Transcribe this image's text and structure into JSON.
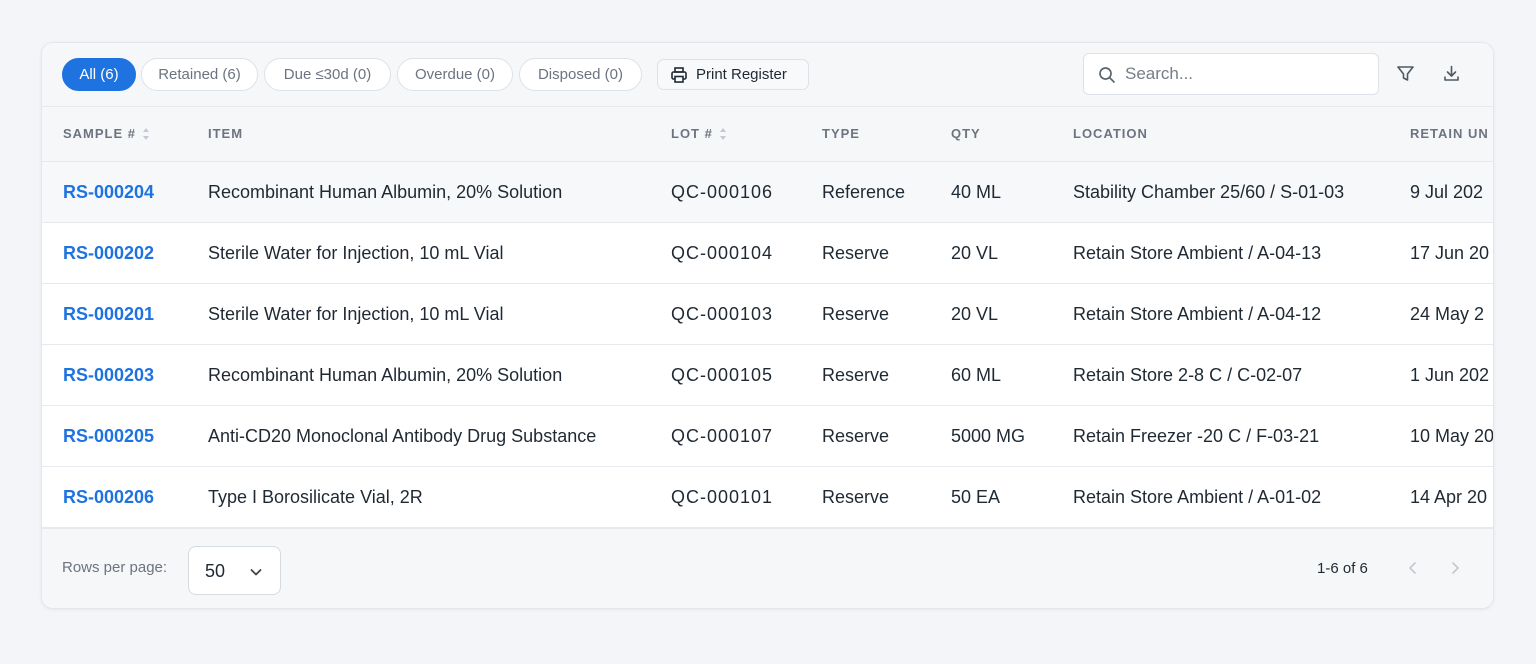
{
  "filters": [
    {
      "label": "All (6)",
      "active": true
    },
    {
      "label": "Retained (6)",
      "active": false
    },
    {
      "label": "Due ≤30d (0)",
      "active": false
    },
    {
      "label": "Overdue (0)",
      "active": false
    },
    {
      "label": "Disposed (0)",
      "active": false
    }
  ],
  "toolbar": {
    "print_label": "Print Register",
    "search_placeholder": "Search..."
  },
  "columns": {
    "sample": "SAMPLE #",
    "item": "ITEM",
    "lot": "LOT #",
    "type": "TYPE",
    "qty": "QTY",
    "location": "LOCATION",
    "retain_until": "RETAIN UN"
  },
  "rows": [
    {
      "sample": "RS-000204",
      "item": "Recombinant Human Albumin, 20% Solution",
      "lot": "QC-000106",
      "type": "Reference",
      "qty": "40 ML",
      "location": "Stability Chamber 25/60 / S-01-03",
      "retain_until": "9 Jul 202"
    },
    {
      "sample": "RS-000202",
      "item": "Sterile Water for Injection, 10 mL Vial",
      "lot": "QC-000104",
      "type": "Reserve",
      "qty": "20 VL",
      "location": "Retain Store Ambient / A-04-13",
      "retain_until": "17 Jun 20"
    },
    {
      "sample": "RS-000201",
      "item": "Sterile Water for Injection, 10 mL Vial",
      "lot": "QC-000103",
      "type": "Reserve",
      "qty": "20 VL",
      "location": "Retain Store Ambient / A-04-12",
      "retain_until": "24 May 2"
    },
    {
      "sample": "RS-000203",
      "item": "Recombinant Human Albumin, 20% Solution",
      "lot": "QC-000105",
      "type": "Reserve",
      "qty": "60 ML",
      "location": "Retain Store 2-8 C / C-02-07",
      "retain_until": "1 Jun 202"
    },
    {
      "sample": "RS-000205",
      "item": "Anti-CD20 Monoclonal Antibody Drug Substance",
      "lot": "QC-000107",
      "type": "Reserve",
      "qty": "5000 MG",
      "location": "Retain Freezer -20 C / F-03-21",
      "retain_until": "10 May 20"
    },
    {
      "sample": "RS-000206",
      "item": "Type I Borosilicate Vial, 2R",
      "lot": "QC-000101",
      "type": "Reserve",
      "qty": "50 EA",
      "location": "Retain Store Ambient / A-01-02",
      "retain_until": "14 Apr 20"
    }
  ],
  "footer": {
    "rows_per_page_label": "Rows per page:",
    "rows_per_page_value": "50",
    "range": "1-6 of 6"
  },
  "colors": {
    "accent": "#1f73e0",
    "header_bg": "#f5f7f9",
    "border": "#e6e9ee"
  }
}
